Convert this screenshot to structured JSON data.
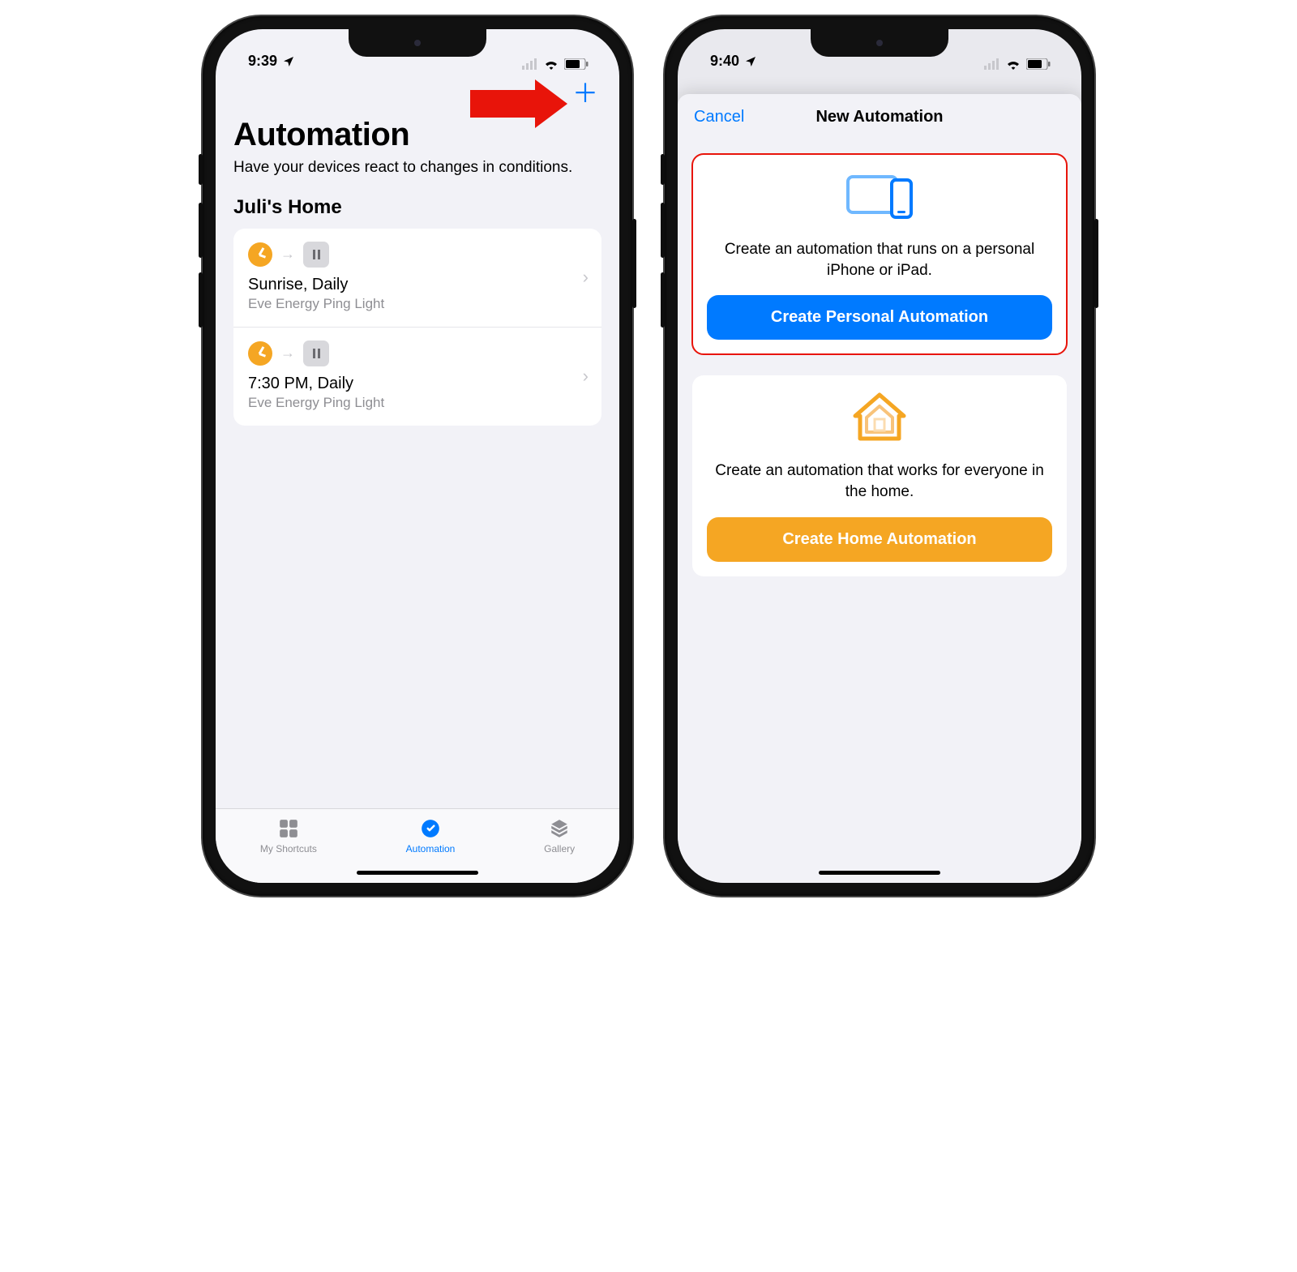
{
  "left": {
    "statusTime": "9:39",
    "pageTitle": "Automation",
    "subtitle": "Have your devices react to changes in conditions.",
    "homeName": "Juli's Home",
    "automations": [
      {
        "title": "Sunrise, Daily",
        "sub": "Eve Energy Ping Light"
      },
      {
        "title": "7:30 PM, Daily",
        "sub": "Eve Energy Ping Light"
      }
    ],
    "tabs": {
      "shortcuts": "My Shortcuts",
      "automation": "Automation",
      "gallery": "Gallery"
    }
  },
  "right": {
    "statusTime": "9:40",
    "cancel": "Cancel",
    "modalTitle": "New Automation",
    "personal": {
      "desc": "Create an automation that runs on a personal iPhone or iPad.",
      "button": "Create Personal Automation"
    },
    "home": {
      "desc": "Create an automation that works for everyone in the home.",
      "button": "Create Home Automation"
    }
  },
  "colors": {
    "accentBlue": "#007aff",
    "accentOrange": "#f5a623",
    "annotRed": "#e8140a"
  }
}
